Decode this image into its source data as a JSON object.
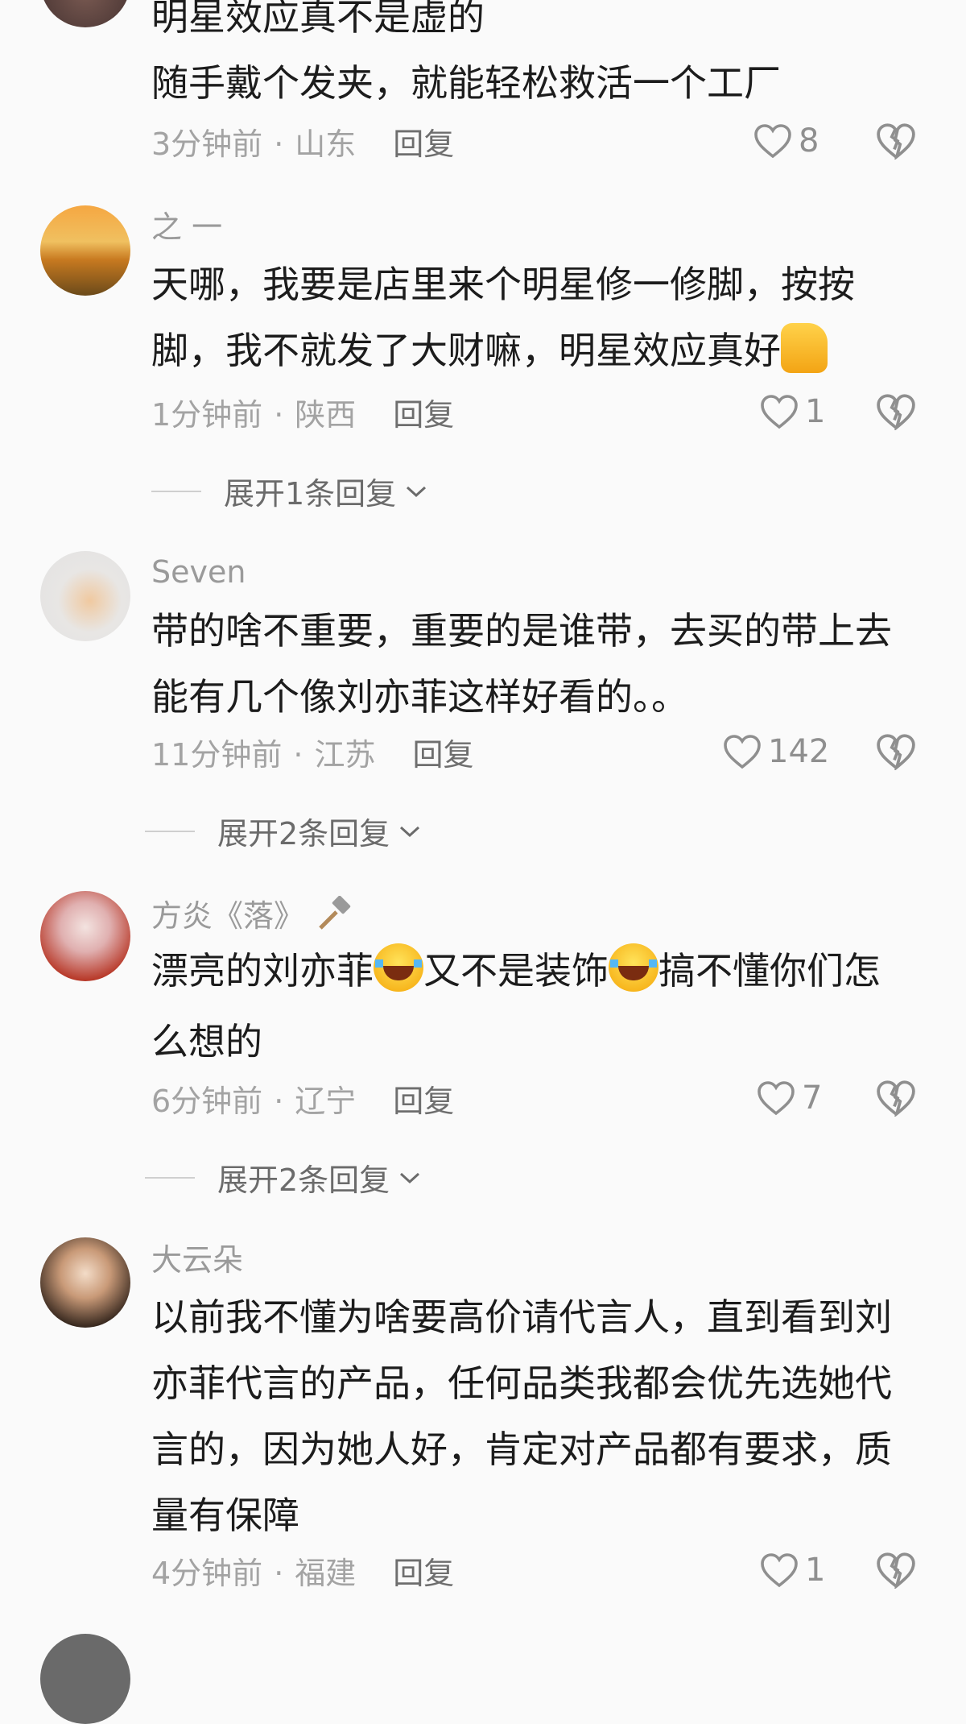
{
  "comments": [
    {
      "username": "",
      "lines": [
        "明星效应真不是虚的",
        "随手戴个发夹，就能轻松救活一个工厂"
      ],
      "time": "3分钟前",
      "region": "山东",
      "reply_label": "回复",
      "likes": "8",
      "avatar_icon": "user-avatar"
    },
    {
      "username": "之 一",
      "lines": [
        "天哪，我要是店里来个明星修一修脚，按按",
        "脚，我不就发了大财嘛，明星效应真好"
      ],
      "time": "1分钟前",
      "region": "陕西",
      "reply_label": "回复",
      "likes": "1",
      "expand_label": "展开1条回复",
      "avatar_icon": "wheat-sunset-avatar",
      "emoji": "thumbs-up-emoji"
    },
    {
      "username": "Seven",
      "lines": [
        "带的啥不重要，重要的是谁带，去买的带上去",
        "能有几个像刘亦菲这样好看的。。"
      ],
      "time": "11分钟前",
      "region": "江苏",
      "reply_label": "回复",
      "likes": "142",
      "expand_label": "展开2条回复",
      "avatar_icon": "cat-avatar"
    },
    {
      "username": "方炎《落》",
      "lines_parts": [
        "漂亮的刘亦菲",
        "又不是装饰",
        "搞不懂你们怎"
      ],
      "line2": "么想的",
      "time": "6分钟前",
      "region": "辽宁",
      "reply_label": "回复",
      "likes": "7",
      "expand_label": "展开2条回复",
      "avatar_icon": "anime-girl-avatar",
      "emoji": "laughing-crying-emoji"
    },
    {
      "username": "大云朵",
      "lines": [
        "以前我不懂为啥要高价请代言人，直到看到刘",
        "亦菲代言的产品，任何品类我都会优先选她代",
        "言的，因为她人好，肯定对产品都有要求，质",
        "量有保障"
      ],
      "time": "4分钟前",
      "region": "福建",
      "reply_label": "回复",
      "likes": "1",
      "avatar_icon": "woman-portrait-avatar"
    }
  ],
  "colors": {
    "background": "#fafafa",
    "text": "#1c1c1c",
    "meta": "#a3a3a3",
    "reply": "#6e6e6e"
  }
}
